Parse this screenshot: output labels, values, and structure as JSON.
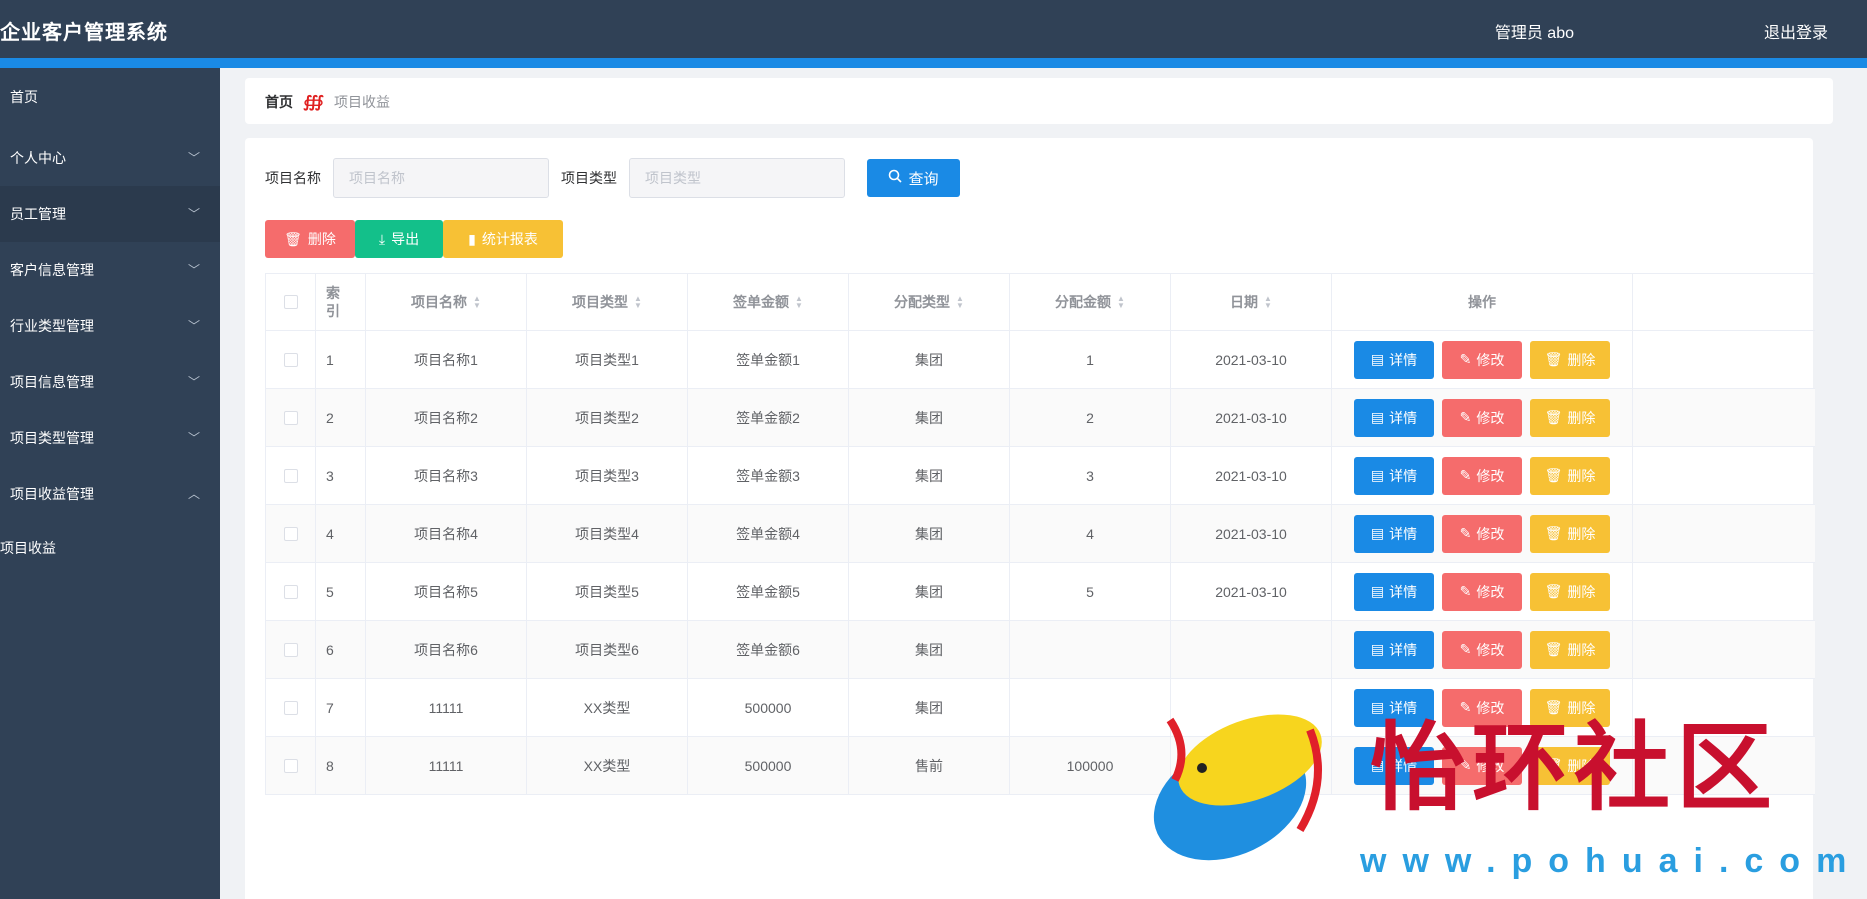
{
  "header": {
    "title": "企业客户管理系统",
    "user": "管理员 abo",
    "logout": "退出登录"
  },
  "sidebar": {
    "items": [
      {
        "label": "首页"
      },
      {
        "label": "个人中心"
      },
      {
        "label": "员工管理"
      },
      {
        "label": "客户信息管理"
      },
      {
        "label": "行业类型管理"
      },
      {
        "label": "项目信息管理"
      },
      {
        "label": "项目类型管理"
      },
      {
        "label": "项目收益管理"
      }
    ],
    "sub_item": "项目收益"
  },
  "breadcrumb": {
    "home": "首页",
    "current": "项目收益"
  },
  "search": {
    "name_label": "项目名称",
    "name_placeholder": "项目名称",
    "type_label": "项目类型",
    "type_placeholder": "项目类型",
    "query_button": "查询"
  },
  "actions": {
    "delete": "删除",
    "export": "导出",
    "report": "统计报表"
  },
  "table": {
    "headers": {
      "index": "索引",
      "name": "项目名称",
      "type": "项目类型",
      "sign_amount": "签单金额",
      "dist_type": "分配类型",
      "dist_amount": "分配金额",
      "date": "日期",
      "ops": "操作"
    },
    "op_labels": {
      "detail": "详情",
      "edit": "修改",
      "delete": "删除"
    },
    "rows": [
      {
        "index": "1",
        "name": "项目名称1",
        "type": "项目类型1",
        "sign_amount": "签单金额1",
        "dist_type": "集团",
        "dist_amount": "1",
        "date": "2021-03-10"
      },
      {
        "index": "2",
        "name": "项目名称2",
        "type": "项目类型2",
        "sign_amount": "签单金额2",
        "dist_type": "集团",
        "dist_amount": "2",
        "date": "2021-03-10"
      },
      {
        "index": "3",
        "name": "项目名称3",
        "type": "项目类型3",
        "sign_amount": "签单金额3",
        "dist_type": "集团",
        "dist_amount": "3",
        "date": "2021-03-10"
      },
      {
        "index": "4",
        "name": "项目名称4",
        "type": "项目类型4",
        "sign_amount": "签单金额4",
        "dist_type": "集团",
        "dist_amount": "4",
        "date": "2021-03-10"
      },
      {
        "index": "5",
        "name": "项目名称5",
        "type": "项目类型5",
        "sign_amount": "签单金额5",
        "dist_type": "集团",
        "dist_amount": "5",
        "date": "2021-03-10"
      },
      {
        "index": "6",
        "name": "项目名称6",
        "type": "项目类型6",
        "sign_amount": "签单金额6",
        "dist_type": "集团",
        "dist_amount": "",
        "date": ""
      },
      {
        "index": "7",
        "name": "11111",
        "type": "XX类型",
        "sign_amount": "500000",
        "dist_type": "集团",
        "dist_amount": "",
        "date": ""
      },
      {
        "index": "8",
        "name": "11111",
        "type": "XX类型",
        "sign_amount": "500000",
        "dist_type": "售前",
        "dist_amount": "100000",
        "date": "2021-03-01"
      }
    ]
  },
  "watermark": {
    "text": "怡环社区",
    "url": "www.pohuai.com"
  }
}
